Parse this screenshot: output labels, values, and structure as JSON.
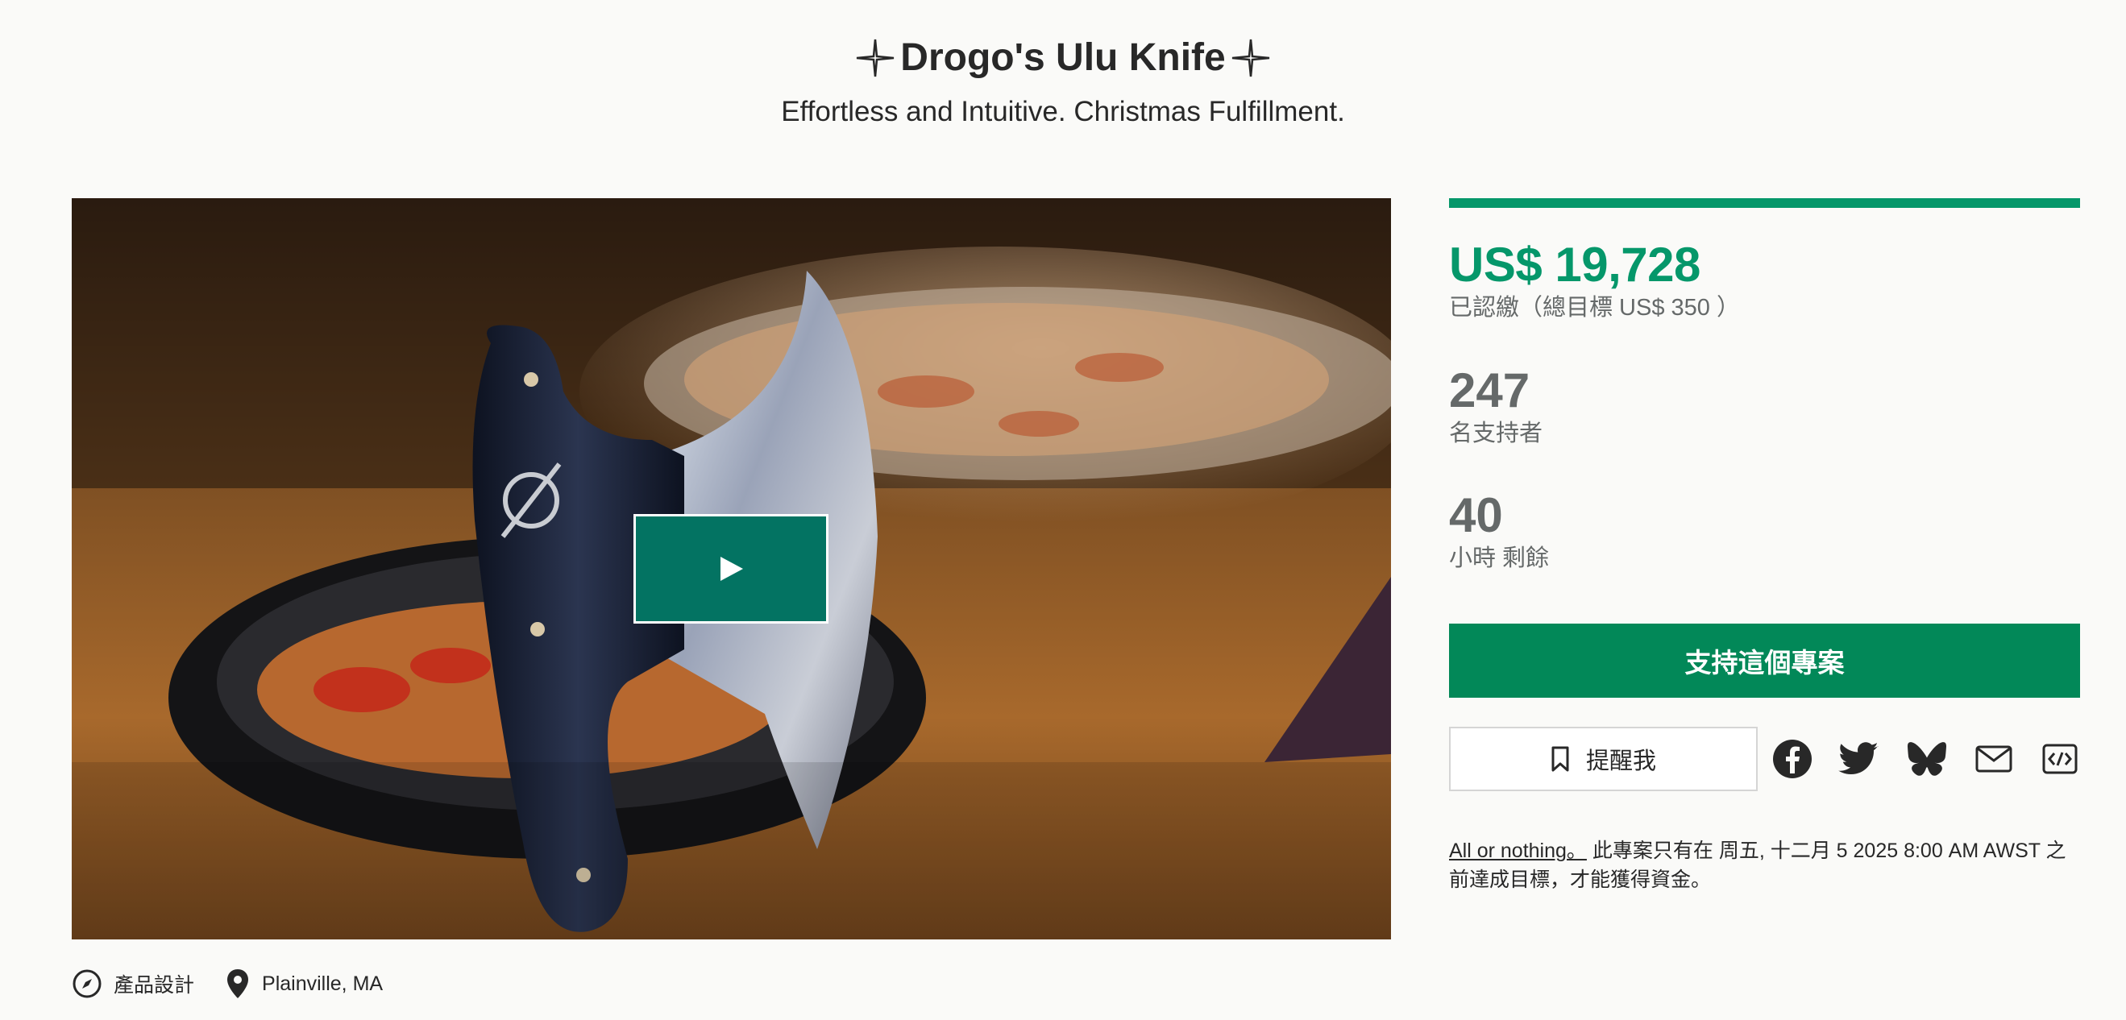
{
  "project": {
    "title": "Drogo's Ulu Knife",
    "subtitle": "Effortless and Intuitive. Christmas Fulfillment."
  },
  "media": {
    "play_icon": "play-icon"
  },
  "meta": {
    "category": "產品設計",
    "category_icon": "compass-icon",
    "location": "Plainville, MA",
    "location_icon": "map-pin-icon"
  },
  "stats": {
    "progress_fraction": 1.0,
    "pledged": "US$ 19,728",
    "pledged_label": "已認繳（總目標 US$ 350 ）",
    "backers": "247",
    "backers_label": "名支持者",
    "time_left": "40",
    "time_left_label": "小時 剩餘"
  },
  "actions": {
    "back_project": "支持這個專案",
    "remind_me": "提醒我",
    "share_icons": [
      "facebook-icon",
      "twitter-icon",
      "bluesky-icon",
      "email-icon",
      "embed-icon"
    ]
  },
  "funding_note": {
    "link": "All or nothing。",
    "text": " 此專案只有在 周五, 十二月 5 2025 8:00 AM AWST 之前達成目標，才能獲得資金。"
  },
  "colors": {
    "accent_green": "#05976a",
    "button_green": "#028858",
    "play_button": "#037362",
    "text_gray": "#656969"
  }
}
